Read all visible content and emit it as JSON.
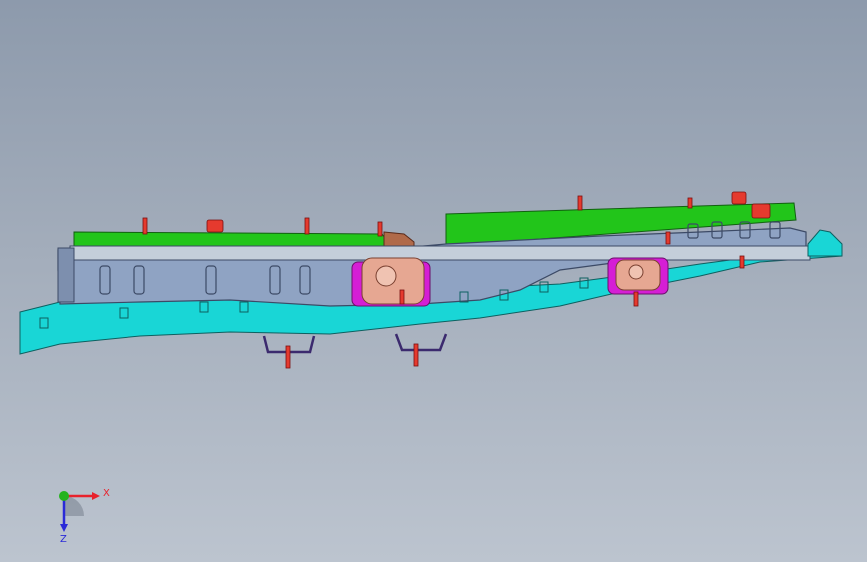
{
  "viewport": {
    "background_top": "#8d9aac",
    "background_bottom": "#bcc4cf"
  },
  "model": {
    "colors": {
      "green_plate": "#22c51a",
      "frame_steel": "#8fa3c3",
      "frame_edge": "#3c4a66",
      "base_cyan": "#19d6d6",
      "locator_pin": "#e53a2e",
      "clamp_pink": "#e6a792",
      "clamp_magenta": "#d51ed5",
      "brown_block": "#b06a4a"
    }
  },
  "triad": {
    "x_label": "X",
    "z_label": "Z",
    "x_color": "#e8222c",
    "y_color": "#24b31d",
    "z_color": "#2a2ad8"
  }
}
